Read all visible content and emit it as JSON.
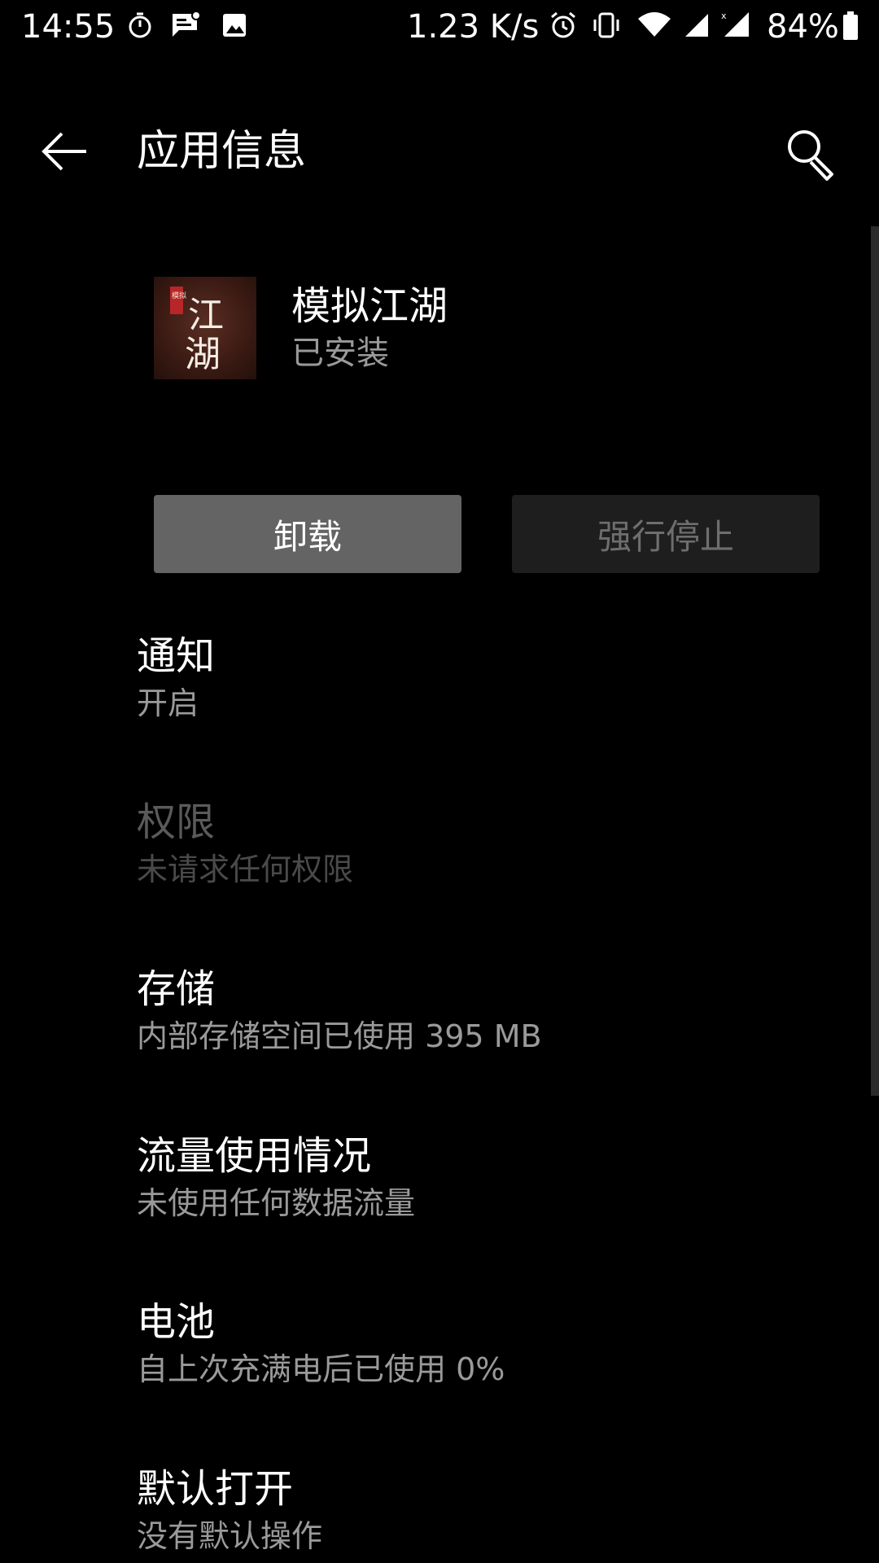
{
  "status_bar": {
    "time": "14:55",
    "net_speed": "1.23 K/s",
    "battery": "84%",
    "left_icons": [
      "timer-icon",
      "message-icon",
      "image-icon"
    ],
    "right_icons": [
      "alarm-icon",
      "vibrate-icon",
      "wifi-icon",
      "signal-icon",
      "signal-x-icon",
      "battery-icon"
    ],
    "battery_level": 0.84
  },
  "toolbar": {
    "title": "应用信息",
    "back_icon": "arrow-left-icon",
    "search_icon": "search-icon"
  },
  "app": {
    "name": "模拟江湖",
    "status": "已安装",
    "icon_text_small": "模拟",
    "icon_text_large_1": "江",
    "icon_text_large_2": "湖"
  },
  "buttons": {
    "uninstall": "卸载",
    "force_stop": "强行停止"
  },
  "items": [
    {
      "title": "通知",
      "subtitle": "开启",
      "enabled": true
    },
    {
      "title": "权限",
      "subtitle": "未请求任何权限",
      "enabled": false
    },
    {
      "title": "存储",
      "subtitle": "内部存储空间已使用 395 MB",
      "enabled": true
    },
    {
      "title": "流量使用情况",
      "subtitle": "未使用任何数据流量",
      "enabled": true
    },
    {
      "title": "电池",
      "subtitle": "自上次充满电后已使用 0%",
      "enabled": true
    },
    {
      "title": "默认打开",
      "subtitle": "没有默认操作",
      "enabled": true
    }
  ],
  "colors": {
    "background": "#000000",
    "primary_text": "#ffffff",
    "secondary_text": "#9a9a9a",
    "disabled_text": "#5a5a5a",
    "uninstall_button": "#646464",
    "force_stop_button": "#1e1e1e"
  }
}
